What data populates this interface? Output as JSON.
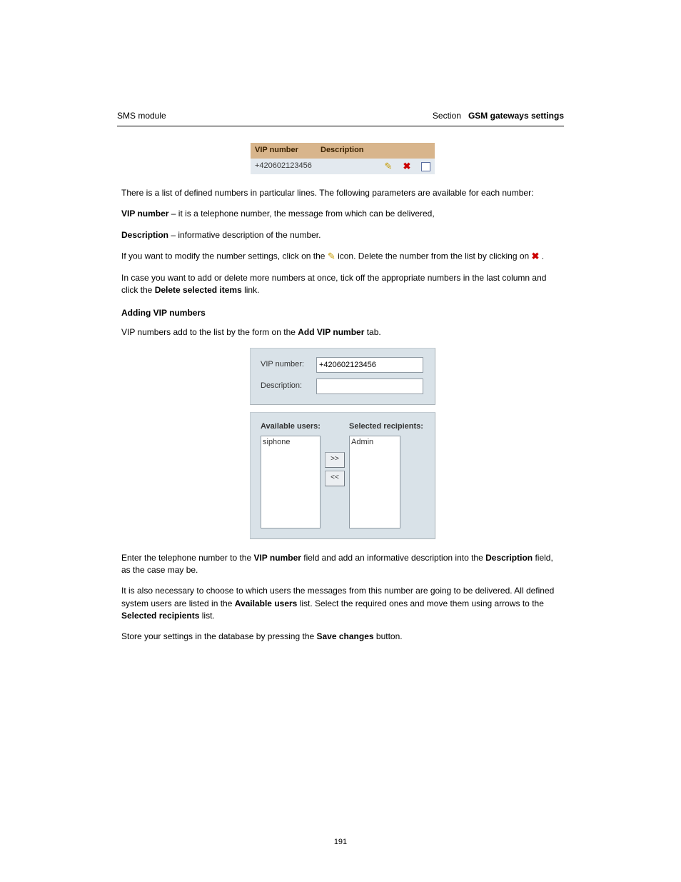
{
  "header": {
    "left": "SMS module",
    "right_prefix": "Section",
    "right_bold": "GSM gateways settings"
  },
  "table": {
    "head_number": "VIP number",
    "head_desc": "Description",
    "row_number": "+420602123456",
    "row_desc": ""
  },
  "body": {
    "p1": "There is a list of defined numbers in particular lines. The following parameters are available for each number:",
    "li_num_label": "VIP number",
    "li_num_text": " – it is a telephone number, the message from which can be delivered,",
    "li_desc_label": "Description",
    "li_desc_text": " – informative description of the number.",
    "p2_a": "If you want to modify the number settings, click on the ",
    "p2_b": " icon. Delete the number from the list by clicking on ",
    "p2_c": " .",
    "p3": "In case you want to add or delete more numbers at once, tick off the appropriate numbers in the last column and click the ",
    "p3_bold": "Delete selected items",
    "p3_end": " link.",
    "subhead": "Adding VIP numbers",
    "p4_a": "VIP numbers add to the list by the form on the ",
    "p4_bold": "Add VIP number",
    "p4_b": " tab.",
    "p5_a": "Enter the telephone number to the ",
    "p5_bold1": "VIP number",
    "p5_b": " field and add an informative description into the ",
    "p5_bold2": "Description",
    "p5_c": " field, as the case may be.",
    "p6_a": "It is also necessary to choose to which users the messages from this number are going to be delivered. All defined system users are listed in the ",
    "p6_bold1": "Available users",
    "p6_b": " list. Select the required ones and move them using arrows to the ",
    "p6_bold2": "Selected recipients",
    "p6_c": " list.",
    "p7_a": "Store your settings in the database by pressing the ",
    "p7_bold": "Save changes",
    "p7_b": " button."
  },
  "form": {
    "vip_label": "VIP number:",
    "vip_value": "+420602123456",
    "desc_label": "Description:",
    "desc_value": "",
    "avail_label": "Available users:",
    "sel_label": "Selected recipients:",
    "avail_list": [
      "siphone"
    ],
    "sel_list": [
      "Admin"
    ],
    "btn_right": ">>",
    "btn_left": "<<"
  },
  "footer": "191"
}
